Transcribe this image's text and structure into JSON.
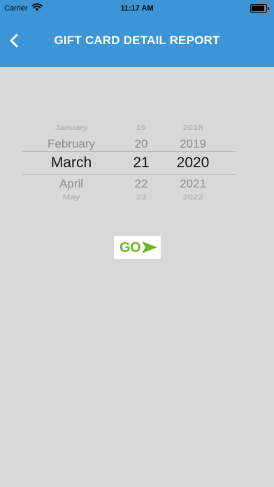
{
  "status_bar": {
    "carrier": "Carrier",
    "time": "11:17 AM",
    "battery_level": 1.0
  },
  "header": {
    "title": "GIFT CARD DETAIL REPORT",
    "back_icon": "chevron-left-icon",
    "background_color": "#3b95d6"
  },
  "picker": {
    "months": [
      "January",
      "February",
      "March",
      "April",
      "May"
    ],
    "days": [
      "19",
      "20",
      "21",
      "22",
      "23"
    ],
    "years": [
      "2018",
      "2019",
      "2020",
      "2021",
      "2022"
    ],
    "selected": {
      "month": "March",
      "day": "21",
      "year": "2020"
    }
  },
  "go_button": {
    "label": "GO",
    "icon": "arrow-right-icon",
    "color": "#6eb41f"
  }
}
